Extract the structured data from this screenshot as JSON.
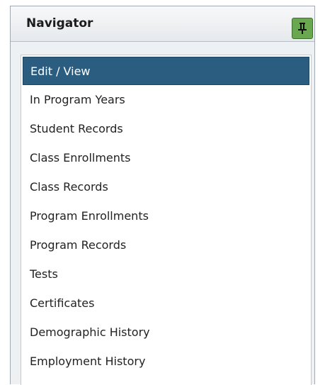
{
  "navigator": {
    "title": "Navigator",
    "pin_icon": "pin-icon",
    "selected_index": 0,
    "colors": {
      "selected_background": "#2b5d80",
      "selected_text": "#ffffff",
      "pin_button": "#6aa84f"
    },
    "items": [
      {
        "label": "Edit / View"
      },
      {
        "label": "In Program Years"
      },
      {
        "label": "Student Records"
      },
      {
        "label": "Class Enrollments"
      },
      {
        "label": "Class Records"
      },
      {
        "label": "Program Enrollments"
      },
      {
        "label": "Program Records"
      },
      {
        "label": "Tests"
      },
      {
        "label": "Certificates"
      },
      {
        "label": "Demographic History"
      },
      {
        "label": "Employment History"
      }
    ]
  }
}
